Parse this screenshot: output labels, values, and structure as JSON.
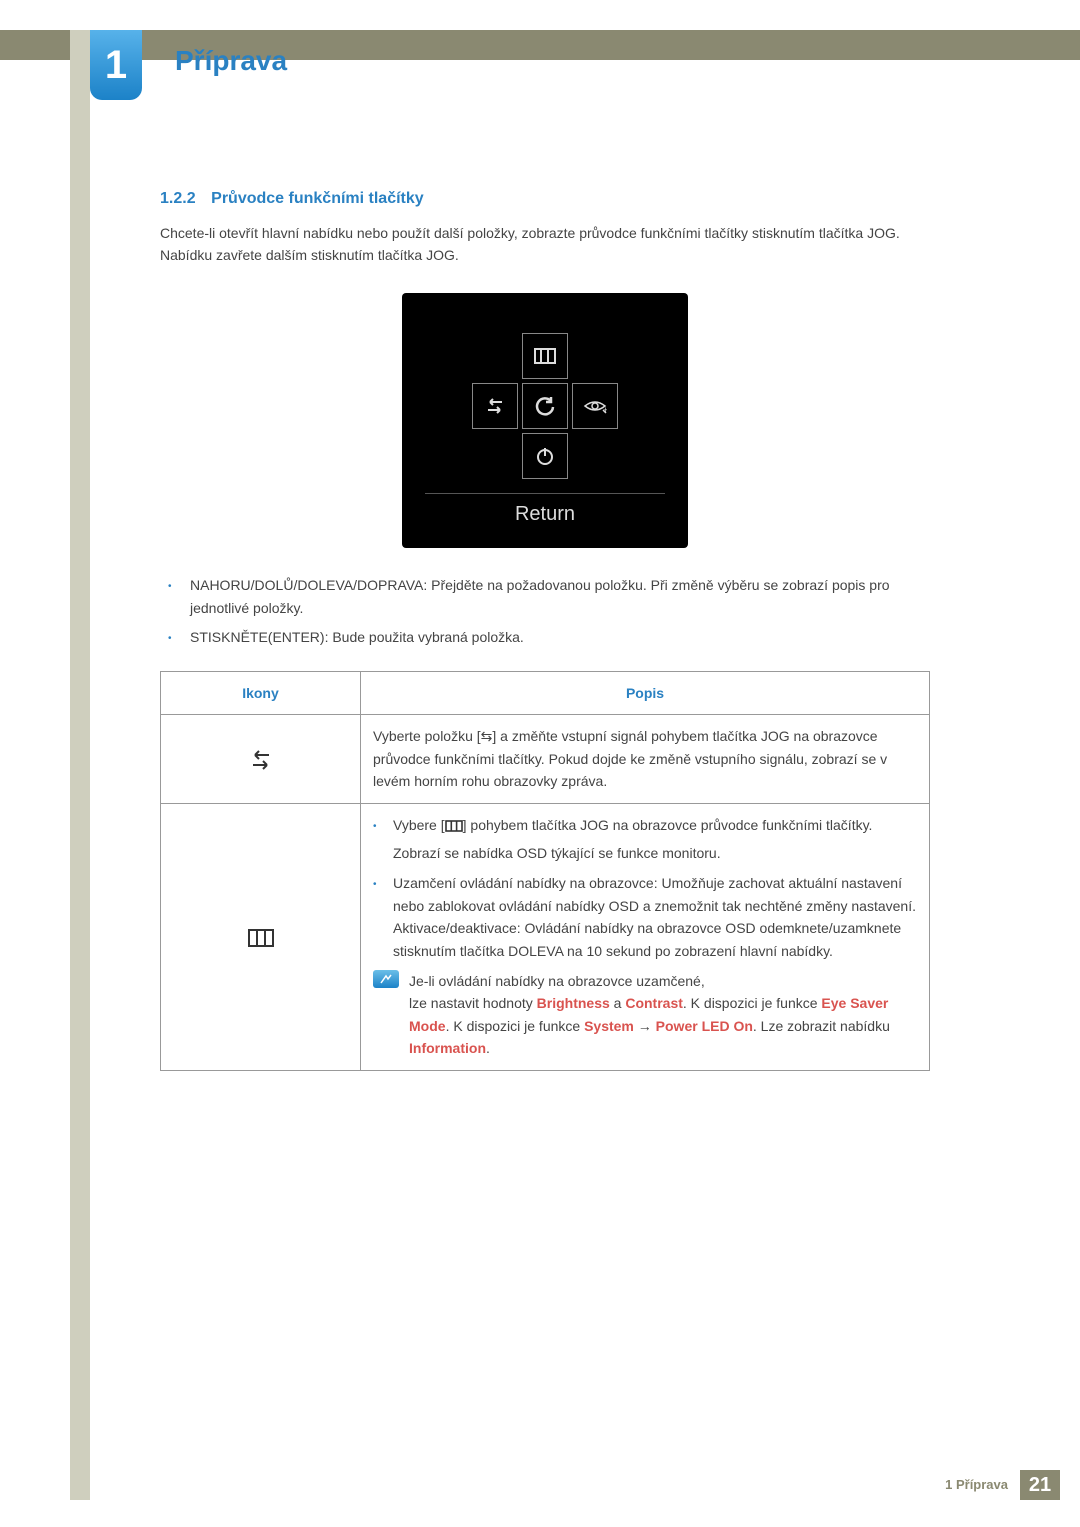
{
  "chapter": {
    "number": "1",
    "title": "Příprava"
  },
  "section": {
    "number": "1.2.2",
    "title": "Průvodce funkčními tlačítky"
  },
  "intro": "Chcete-li otevřít hlavní nabídku nebo použít další položky, zobrazte průvodce funkčními tlačítky stisknutím tlačítka JOG. Nabídku zavřete dalším stisknutím tlačítka JOG.",
  "osd": {
    "label": "Return"
  },
  "bullets": [
    "NAHORU/DOLŮ/DOLEVA/DOPRAVA: Přejděte na požadovanou položku. Při změně výběru se zobrazí popis pro jednotlivé položky.",
    "STISKNĚTE(ENTER): Bude použita vybraná položka."
  ],
  "table": {
    "headers": {
      "icons": "Ikony",
      "desc": "Popis"
    },
    "rows": [
      {
        "icon": "source-switch",
        "desc_plain": "Vyberte položku [⇆] a změňte vstupní signál pohybem tlačítka JOG na obrazovce průvodce funkčními tlačítky. Pokud dojde ke změně vstupního signálu, zobrazí se v levém horním rohu obrazovky zpráva."
      },
      {
        "icon": "menu",
        "desc_items": [
          {
            "pre": "Vybere [",
            "icon": "menu-small",
            "post": "] pohybem tlačítka JOG na obrazovce průvodce funkčními tlačítky.",
            "tail": "Zobrazí se nabídka OSD týkající se funkce monitoru."
          },
          {
            "text": "Uzamčení ovládání nabídky na obrazovce: Umožňuje zachovat aktuální nastavení nebo zablokovat ovládání nabídky OSD a znemožnit tak nechtěné změny nastavení. Aktivace/deaktivace: Ovládání nabídky na obrazovce OSD odemknete/uzamknete stisknutím tlačítka DOLEVA na 10 sekund po zobrazení hlavní nabídky."
          }
        ],
        "note": {
          "line1": "Je-li ovládání nabídky na obrazovce uzamčené,",
          "line2_pre": "lze nastavit hodnoty ",
          "brightness": "Brightness",
          "and": " a ",
          "contrast": "Contrast",
          "line2_mid": ". K dispozici je funkce ",
          "eyesaver": "Eye Saver Mode",
          "line3_pre": ". K dispozici je funkce ",
          "system": "System",
          "arrow": " → ",
          "powerled": "Power LED On",
          "line3_mid": ". Lze zobrazit nabídku ",
          "information": "Information",
          "end": "."
        }
      }
    ]
  },
  "footer": {
    "text": "1 Příprava",
    "page": "21"
  }
}
